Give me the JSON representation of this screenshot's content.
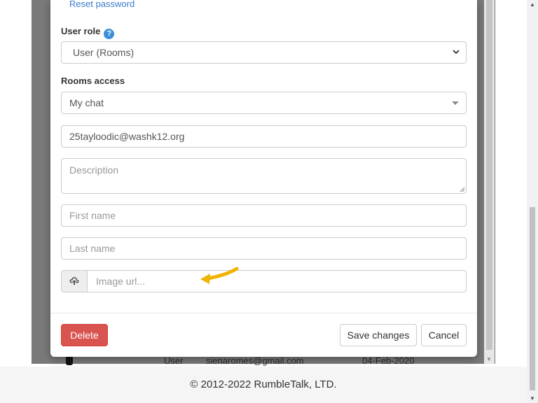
{
  "modal": {
    "reset_password": "Reset password",
    "user_role_label": "User role",
    "user_role_value": "User (Rooms)",
    "rooms_access_label": "Rooms access",
    "rooms_access_value": "My chat",
    "email_value": "25tayloodic@washk12.org",
    "description_placeholder": "Description",
    "first_name_placeholder": "First name",
    "last_name_placeholder": "Last name",
    "image_url_placeholder": "Image url...",
    "help_glyph": "?",
    "delete_label": "Delete",
    "save_label": "Save changes",
    "cancel_label": "Cancel"
  },
  "background_row": {
    "role": "User",
    "email": "sienaromes@gmail.com",
    "date": "04-Feb-2020"
  },
  "footer": {
    "copyright": "© 2012-2022 RumbleTalk, LTD."
  },
  "colors": {
    "link": "#3a7bc8",
    "help_icon": "#3a8fd8",
    "danger": "#d9534f",
    "annotation_arrow": "#f0b400"
  },
  "icons": {
    "help": "question-circle-icon",
    "upload": "cloud-upload-icon",
    "select": "chevron-down-icon",
    "annotation": "arrow-annotation"
  }
}
